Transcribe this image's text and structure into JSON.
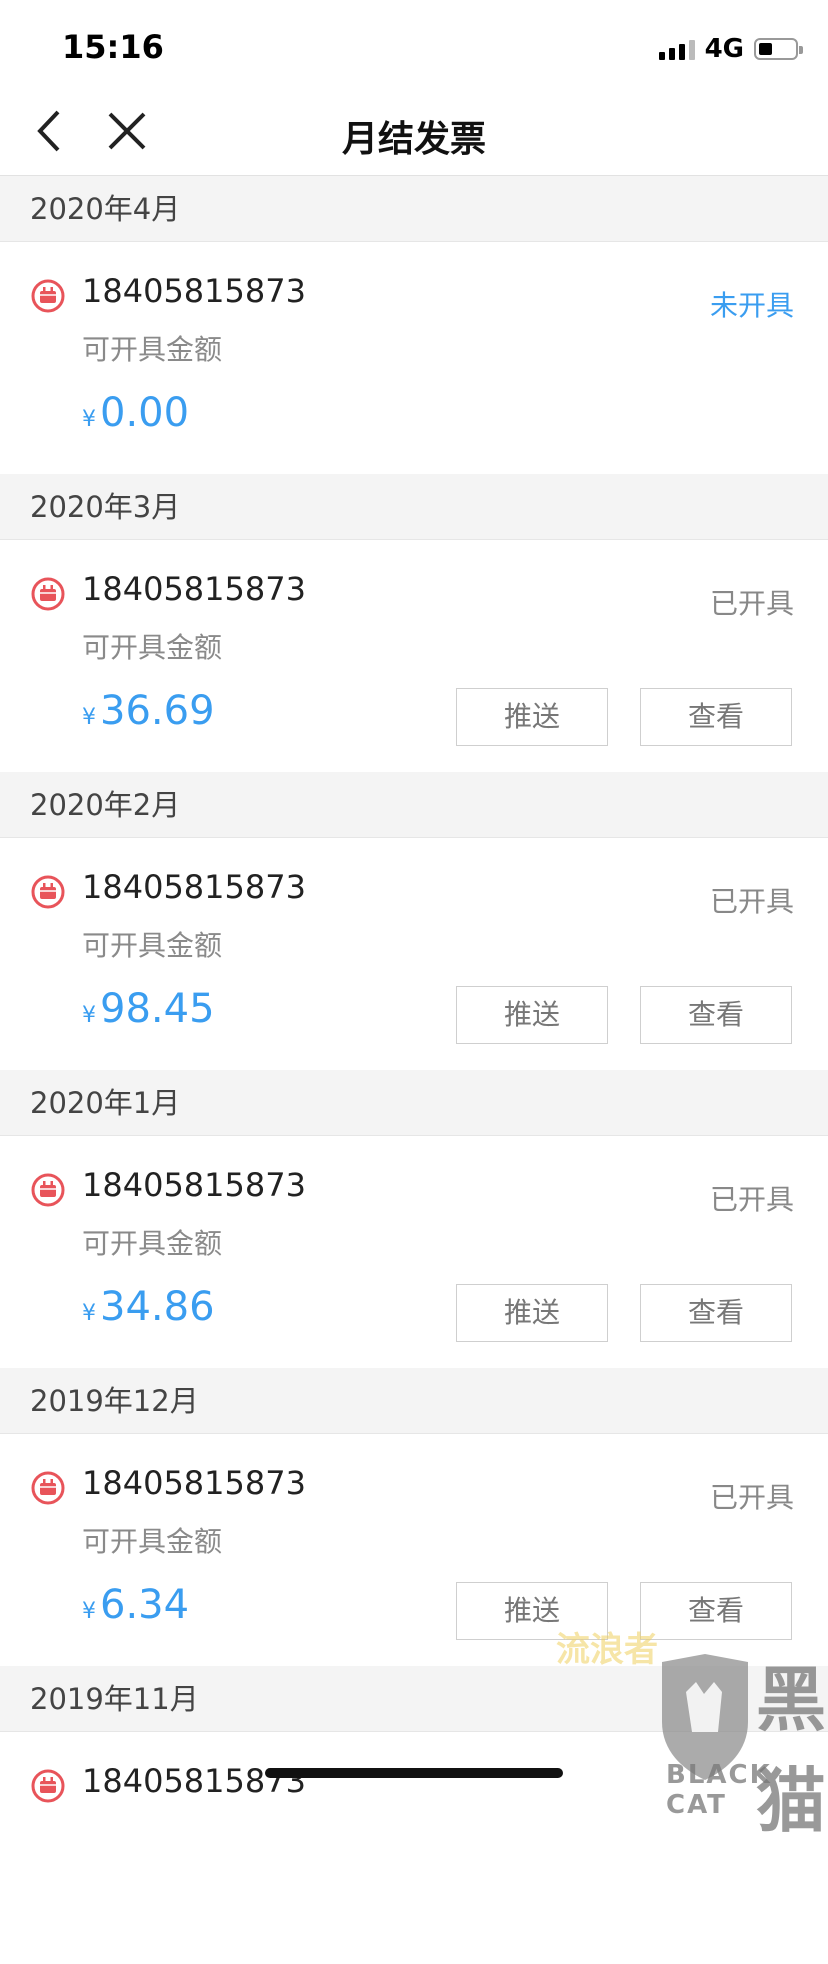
{
  "status_bar": {
    "time": "15:16",
    "network": "4G"
  },
  "nav": {
    "title": "月结发票"
  },
  "months": [
    {
      "month": "2020年4月",
      "phone": "18405815873",
      "label": "可开具金额",
      "status": "未开具",
      "status_color": "#3a9df0",
      "yen": "¥",
      "amount": "0.00",
      "buttons": false
    },
    {
      "month": "2020年3月",
      "phone": "18405815873",
      "label": "可开具金额",
      "status": "已开具",
      "yen": "¥",
      "amount": "36.69",
      "buttons": true,
      "push": "推送",
      "view": "查看"
    },
    {
      "month": "2020年2月",
      "phone": "18405815873",
      "label": "可开具金额",
      "status": "已开具",
      "yen": "¥",
      "amount": "98.45",
      "buttons": true,
      "push": "推送",
      "view": "查看"
    },
    {
      "month": "2020年1月",
      "phone": "18405815873",
      "label": "可开具金额",
      "status": "已开具",
      "yen": "¥",
      "amount": "34.86",
      "buttons": true,
      "push": "推送",
      "view": "查看"
    },
    {
      "month": "2019年12月",
      "phone": "18405815873",
      "label": "可开具金额",
      "status": "已开具",
      "yen": "¥",
      "amount": "6.34",
      "buttons": true,
      "push": "推送",
      "view": "查看"
    },
    {
      "month": "2019年11月",
      "phone": "18405815873"
    }
  ],
  "watermark": {
    "small": "流浪者",
    "brand_cn": "黑猫",
    "brand_en": "BLACK CAT"
  },
  "colors": {
    "accent": "#3a9df0",
    "icon": "#e8545a"
  }
}
